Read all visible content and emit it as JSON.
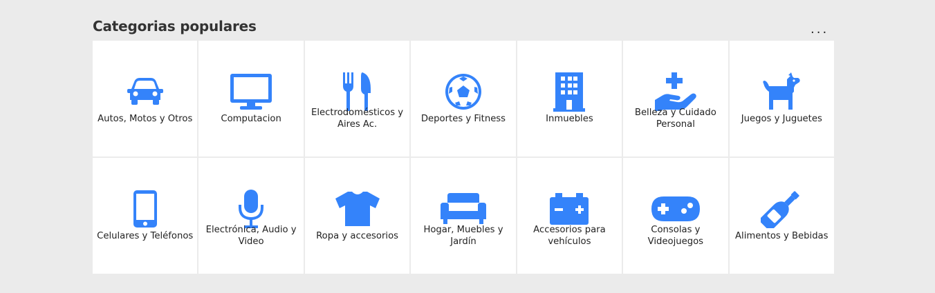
{
  "header": {
    "title": "Categorias populares",
    "more_label": "..."
  },
  "colors": {
    "accent": "#3483fa",
    "background": "#ebebeb",
    "card": "#ffffff"
  },
  "categories": [
    {
      "label": "Autos, Motos y Otros",
      "icon": "car-icon"
    },
    {
      "label": "Computacion",
      "icon": "monitor-icon"
    },
    {
      "label": "Electrodomésticos y Aires Ac.",
      "icon": "utensils-icon"
    },
    {
      "label": "Deportes y Fitness",
      "icon": "soccer-ball-icon"
    },
    {
      "label": "Inmuebles",
      "icon": "building-icon"
    },
    {
      "label": "Belleza y Cuidado Personal",
      "icon": "hand-holding-medical-icon"
    },
    {
      "label": "Juegos y Juguetes",
      "icon": "dog-icon"
    },
    {
      "label": "Celulares y Teléfonos",
      "icon": "mobile-phone-icon"
    },
    {
      "label": "Electrónica, Audio y Video",
      "icon": "microphone-icon"
    },
    {
      "label": "Ropa y accesorios",
      "icon": "t-shirt-icon"
    },
    {
      "label": "Hogar, Muebles y Jardín",
      "icon": "couch-icon"
    },
    {
      "label": "Accesorios para vehículos",
      "icon": "car-battery-icon"
    },
    {
      "label": "Consolas y Videojuegos",
      "icon": "gamepad-icon"
    },
    {
      "label": "Alimentos y Bebidas",
      "icon": "wine-bottle-icon"
    }
  ]
}
